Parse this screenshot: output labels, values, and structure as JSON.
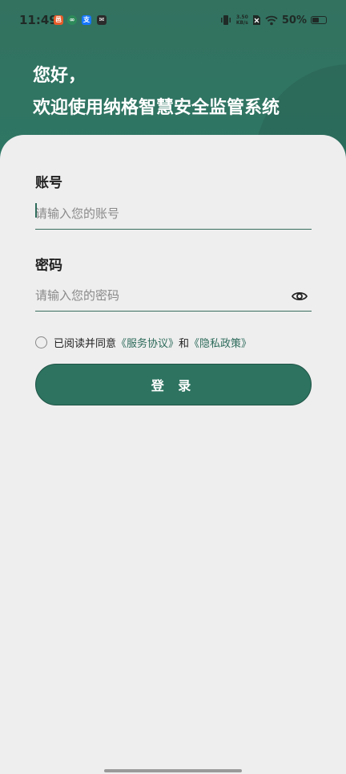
{
  "status_bar": {
    "time": "11:49",
    "app_icons": [
      {
        "name": "app-icon-1",
        "glyph": "邑",
        "color": "#e85c2a"
      },
      {
        "name": "app-icon-2",
        "glyph": "∞",
        "color": "#2d8a5a"
      },
      {
        "name": "app-icon-3",
        "glyph": "支",
        "color": "#1677ff"
      },
      {
        "name": "app-icon-4",
        "glyph": "✉",
        "color": "#2b2b2b"
      }
    ],
    "net_speed_value": "3.50",
    "net_speed_unit": "KB/s",
    "battery_text": "50%",
    "battery_level": 0.5
  },
  "greeting": {
    "line1": "您好，",
    "line2": "欢迎使用纳格智慧安全监管系统"
  },
  "account": {
    "label": "账号",
    "placeholder": "请输入您的账号"
  },
  "password": {
    "label": "密码",
    "placeholder": "请输入您的密码"
  },
  "agreement": {
    "prefix": "已阅读并同意",
    "service_link": "《服务协议》",
    "conjunction": "和",
    "privacy_link": "《隐私政策》"
  },
  "login_button": {
    "label": "登 录"
  },
  "colors": {
    "primary": "#2d7360",
    "header": "#33725f",
    "background": "#eeeeee"
  }
}
